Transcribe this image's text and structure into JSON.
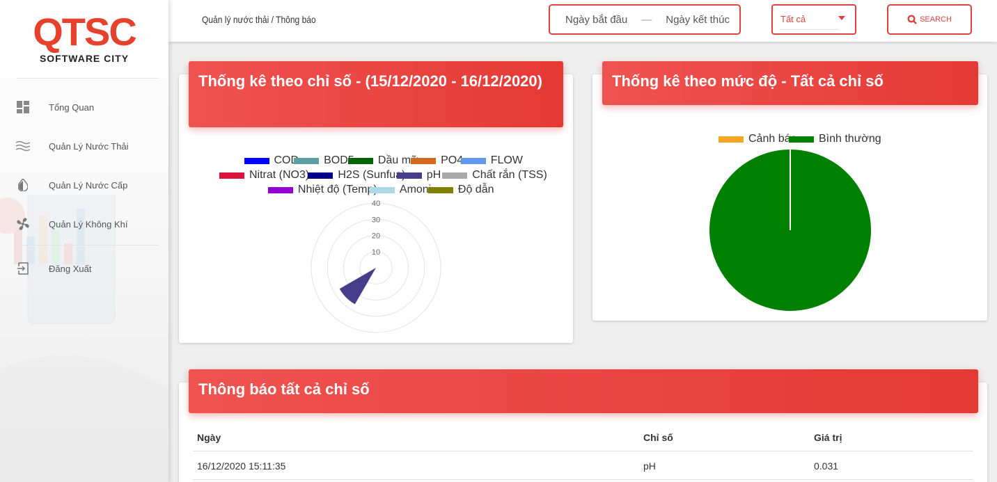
{
  "sidebar": {
    "logo_mark": "QTSC",
    "logo_sub": "SOFTWARE CITY",
    "items": [
      {
        "label": "Tổng Quan",
        "icon": "dashboard-icon"
      },
      {
        "label": "Quản Lý Nước Thải",
        "icon": "waves-icon"
      },
      {
        "label": "Quản Lý Nước Cấp",
        "icon": "water-drop-icon"
      },
      {
        "label": "Quản Lý Không Khí",
        "icon": "fan-icon"
      },
      {
        "label": "Đăng Xuất",
        "icon": "logout-icon"
      }
    ]
  },
  "header": {
    "breadcrumb": "Quản lý nước thải  /  Thông báo",
    "date_start_placeholder": "Ngày bắt đầu",
    "date_separator": "—",
    "date_end_placeholder": "Ngày kết thúc",
    "filter_value": "Tất cả",
    "search_label": "SEARCH"
  },
  "colors": {
    "accent": "#e53935",
    "normal": "#008000",
    "warning": "#f5a623"
  },
  "cards": {
    "by_index_title": "Thống kê theo chỉ số - (15/12/2020 - 16/12/2020)",
    "by_level_title": "Thống kê theo mức độ - Tất cả chỉ số",
    "notifications_title": "Thông báo tất cả chỉ số"
  },
  "chart_data": [
    {
      "type": "polarArea",
      "series": [
        {
          "name": "COD",
          "color": "#0000ff",
          "value": 0
        },
        {
          "name": "BOD5",
          "color": "#5f9ea0",
          "value": 0
        },
        {
          "name": "Dầu mỡ",
          "color": "#006400",
          "value": 0
        },
        {
          "name": "PO4",
          "color": "#d2691e",
          "value": 0
        },
        {
          "name": "FLOW",
          "color": "#6495ed",
          "value": 0
        },
        {
          "name": "Nitrat (NO3)",
          "color": "#dc143c",
          "value": 0
        },
        {
          "name": "H2S (Sunfua)",
          "color": "#00008b",
          "value": 0
        },
        {
          "name": "pH",
          "color": "#483d8b",
          "value": 26
        },
        {
          "name": "Chất rắn (TSS)",
          "color": "#a9a9a9",
          "value": 0
        },
        {
          "name": "Nhiệt độ (Temp)",
          "color": "#9400d3",
          "value": 0
        },
        {
          "name": "Amoni",
          "color": "#add8e6",
          "value": 0
        },
        {
          "name": "Độ dẫn",
          "color": "#808000",
          "value": 0
        }
      ],
      "r_ticks": [
        "10",
        "20",
        "30",
        "40"
      ],
      "r_max": 40
    },
    {
      "type": "pie",
      "series": [
        {
          "name": "Cảnh báo",
          "color": "#f5a623",
          "value": 0
        },
        {
          "name": "Bình thường",
          "color": "#008000",
          "value": 1
        }
      ]
    }
  ],
  "table": {
    "columns": [
      "Ngày",
      "Chỉ số",
      "Giá trị"
    ],
    "rows": [
      [
        "16/12/2020 15:11:35",
        "pH",
        "0.031"
      ]
    ]
  }
}
